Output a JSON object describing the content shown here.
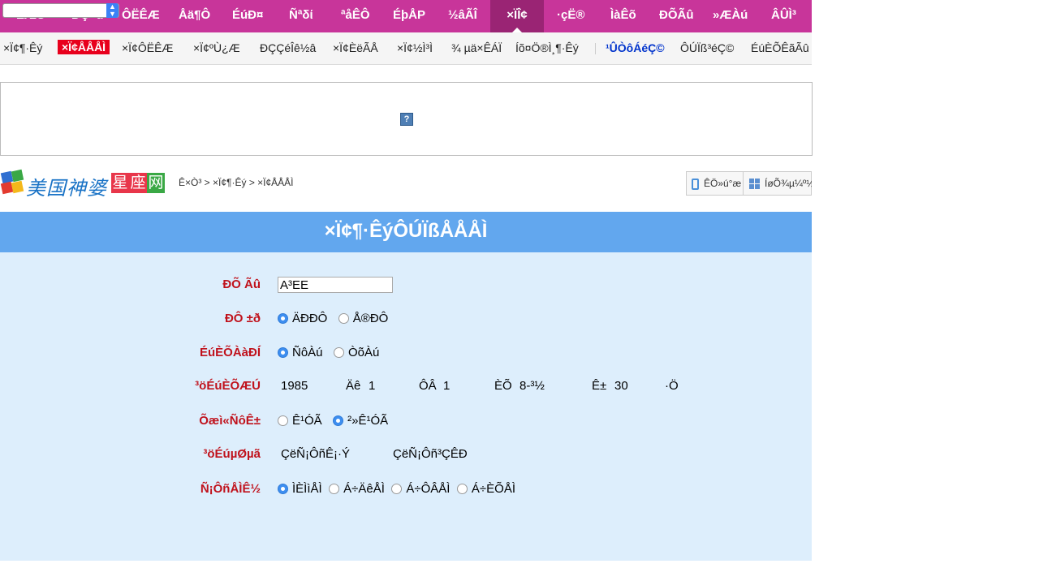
{
  "top_select": {
    "value": ""
  },
  "topnav": {
    "items": [
      {
        "label": "ÊÆÜ"
      },
      {
        "label": "ÐÇ×ù"
      },
      {
        "label": "ÔËÊÆ"
      },
      {
        "label": "Åä¶Ô"
      },
      {
        "label": "ÉúÐ¤"
      },
      {
        "label": "Ñªδί"
      },
      {
        "label": "ªåÊÔ"
      },
      {
        "label": "ÉþÅP"
      },
      {
        "label": "½âÃÎ"
      },
      {
        "label": "×ÏÎ¢"
      },
      {
        "label": "·çË®"
      },
      {
        "label": "ÌàÊõ"
      },
      {
        "label": "ÐÕÃû"
      },
      {
        "label": "»ÆÀú"
      },
      {
        "label": "ÂÛÌ³"
      }
    ]
  },
  "subnav": {
    "items": [
      {
        "label": "×Ï¢¶·Êý"
      },
      {
        "label": "×Ï¢ÅÅÅÌ"
      },
      {
        "label": "×Ï¢ÔËÊÆ"
      },
      {
        "label": "×Ï¢ºÙ¿Æ"
      },
      {
        "label": "ÐÇÇéÎê½â"
      },
      {
        "label": "×Ï¢ÈëÃÅ"
      },
      {
        "label": "×Ï¢½Ì³Ì"
      },
      {
        "label": "¾ µä×ÊÁÏ"
      },
      {
        "label": "Íõ¤Ö®Ì¸¶·Êý"
      },
      {
        "label": "¹ÛÒôÁéÇ©"
      },
      {
        "label": "ÔÚÏß³éÇ©"
      },
      {
        "label": "ÉúÈÕÊãÃû"
      }
    ]
  },
  "logo": {
    "name": "美国神婆",
    "tag": [
      "星",
      "座",
      "网"
    ]
  },
  "breadcrumb": "Ê×Ò³ > ×Ï¢¶·Êý > ×Ï¢ÅÅÅÌ",
  "buttons": {
    "mobile": "ÊÖ»ú°æ",
    "nav": "ÍøÕ¾µ¼º½"
  },
  "form": {
    "title": "×Ï¢¶·ÊýÔÚÏßÅÅÅÌ",
    "name_label": "ÐÕ Ãû",
    "name_value": "A³EE",
    "gender_label": "ÐÔ ±ð",
    "gender_options": [
      "ÄÐÐÔ",
      "Å®ÐÔ"
    ],
    "gender_selected": 0,
    "calendar_label": "ÉúÈÕÀàÐÍ",
    "calendar_options": [
      "ÑôÀú",
      "ÒõÀú"
    ],
    "calendar_selected": 0,
    "birth_label": "³öÉúÈÕÆÚ",
    "birth_year": "1985",
    "birth_year_unit": "Äê",
    "birth_month": "1",
    "birth_month_unit": "ÔÂ",
    "birth_day_label": "ÈÕ",
    "birth_day": "8-³½",
    "birth_hour_label": "Ê±",
    "birth_hour": "30",
    "birth_min_unit": "·Ö",
    "leap_label": "Õæì«ÑôÊ±",
    "leap_options": [
      "Ê¹ÓÃ",
      "²»Ê¹ÓÃ"
    ],
    "leap_selected": 1,
    "place_label": "³öÉúµØµã",
    "place_province": "ÇëÑ¡ÔñÊ¡·Ý",
    "place_city": "ÇëÑ¡Ôñ³ÇÊÐ",
    "style_label": "Ñ¡ÔñÅÌÊ½",
    "style_options": [
      "ÌÈÌìÅÌ",
      "Á÷ÄêÅÌ",
      "Á÷ÔÂÅÌ",
      "Á÷ÈÕÅÌ"
    ],
    "style_selected": 0
  },
  "colors": {
    "topnav": "#c8359a",
    "topnav_active": "#9a2474",
    "panel_head": "#62a7ee",
    "panel_bg": "#ddeefc",
    "label": "#c0121c",
    "accent_red": "#e8001c"
  }
}
